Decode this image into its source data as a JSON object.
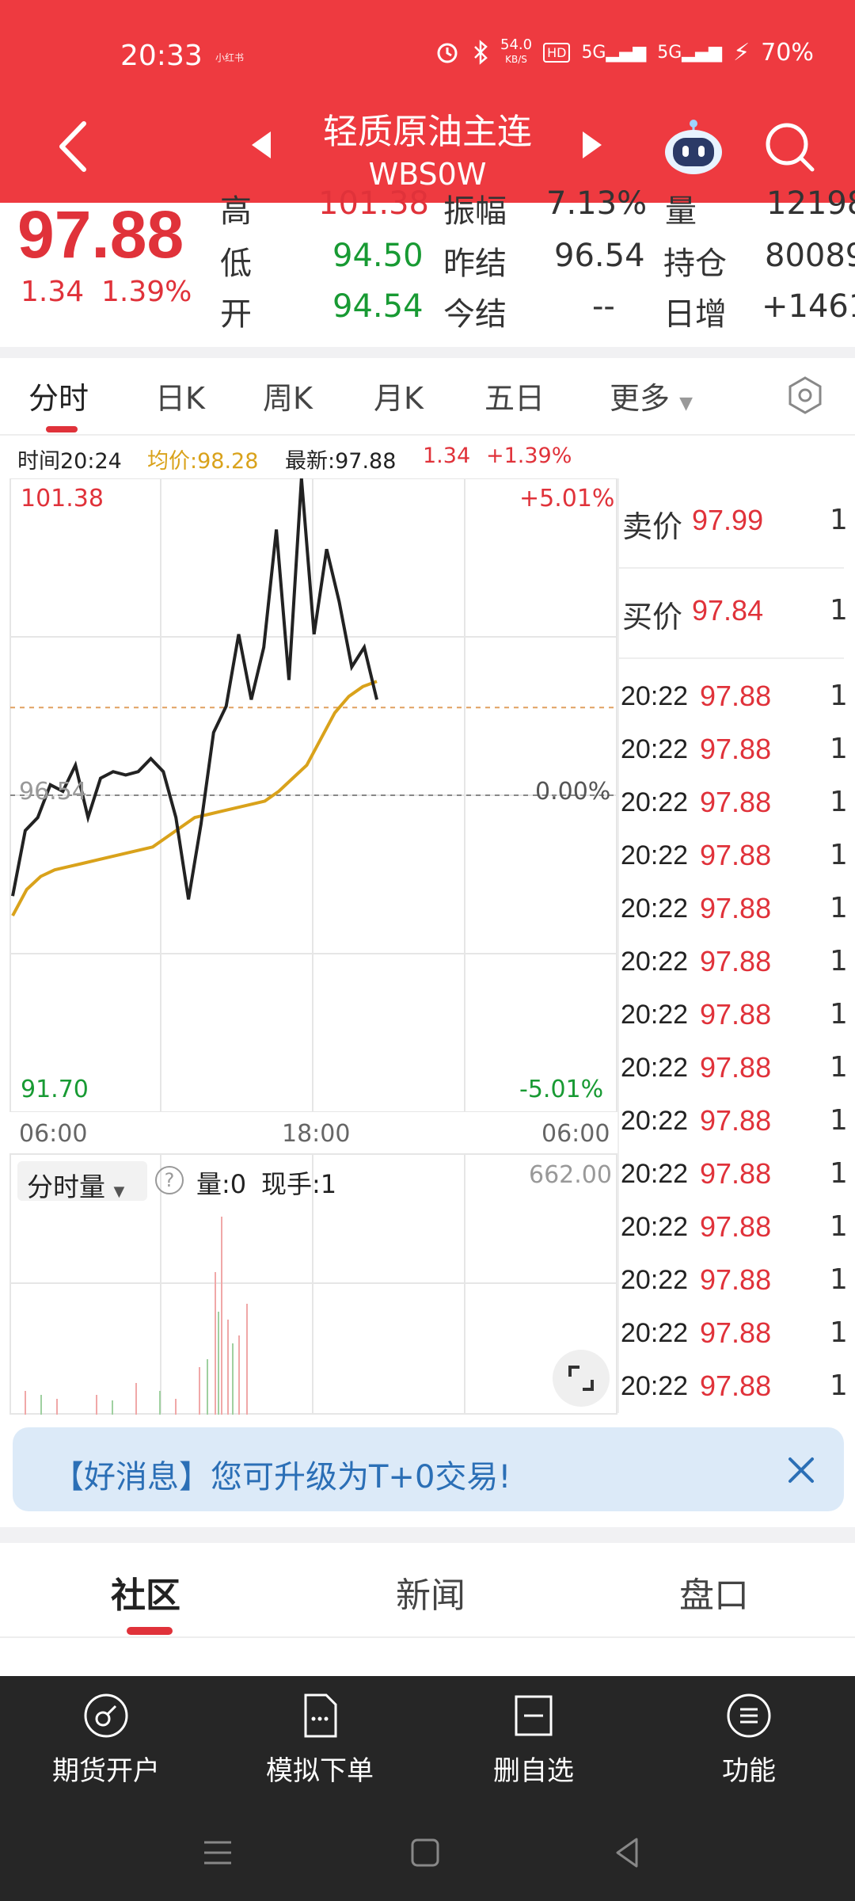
{
  "status_bar": {
    "time": "20:33",
    "tag": "小红书",
    "net_speed": "54.0",
    "net_unit": "KB/S",
    "hd": "HD",
    "signal1": "5G",
    "signal2": "5G",
    "battery": "70%"
  },
  "header": {
    "title": "轻质原油主连",
    "code": "WBS0W"
  },
  "quote": {
    "price": "97.88",
    "change": "1.34",
    "change_pct": "1.39%",
    "high_label": "高",
    "high_value": "101.38",
    "amp_label": "振幅",
    "amp_value": "7.13%",
    "vol_label": "量",
    "vol_value": "12198",
    "low_label": "低",
    "low_value": "94.50",
    "prev_label": "昨结",
    "prev_value": "96.54",
    "oi_label": "持仓",
    "oi_value": "80089",
    "open_label": "开",
    "open_value": "94.54",
    "settle_label": "今结",
    "settle_value": "--",
    "daily_inc_label": "日增",
    "daily_inc_value": "+1461"
  },
  "chart_tabs": [
    "分时",
    "日K",
    "周K",
    "月K",
    "五日",
    "更多"
  ],
  "info_bar": {
    "time": "时间20:24",
    "avg": "均价:98.28",
    "latest": "最新:97.88",
    "change": "1.34",
    "change_pct": "+1.39%"
  },
  "chart_data": {
    "type": "line",
    "y_max_label": "101.38",
    "y_mid_label": "96.54",
    "y_min_label": "91.70",
    "pct_max_label": "+5.01%",
    "pct_mid_label": "0.00%",
    "pct_min_label": "-5.01%",
    "x_labels": [
      "06:00",
      "18:00",
      "06:00"
    ],
    "ylim": [
      91.7,
      101.38
    ],
    "series": [
      {
        "values": [
          95.0,
          96.0,
          96.2,
          96.7,
          96.6,
          97.0,
          96.2,
          96.8,
          96.9,
          96.85,
          96.9,
          97.1,
          96.9,
          96.2,
          94.95,
          96.1,
          97.5,
          97.9,
          99.0,
          98.0,
          98.8,
          100.6,
          98.3,
          101.38,
          99.0,
          100.3,
          99.5,
          98.5,
          98.8,
          98.0
        ]
      },
      {
        "values": [
          94.7,
          95.1,
          95.3,
          95.4,
          95.45,
          95.5,
          95.55,
          95.6,
          95.65,
          95.7,
          95.75,
          95.9,
          96.05,
          96.2,
          96.25,
          96.3,
          96.35,
          96.4,
          96.45,
          96.6,
          96.8,
          97.0,
          97.4,
          97.8,
          98.05,
          98.2,
          98.28
        ]
      }
    ],
    "volume_max_label": "662.00"
  },
  "order_book": {
    "ask_label": "卖价",
    "ask_price": "97.99",
    "ask_vol": "1",
    "bid_label": "买价",
    "bid_price": "97.84",
    "bid_vol": "1",
    "ticks": [
      {
        "time": "20:22",
        "price": "97.88",
        "vol": "1"
      },
      {
        "time": "20:22",
        "price": "97.88",
        "vol": "1"
      },
      {
        "time": "20:22",
        "price": "97.88",
        "vol": "1"
      },
      {
        "time": "20:22",
        "price": "97.88",
        "vol": "1"
      },
      {
        "time": "20:22",
        "price": "97.88",
        "vol": "1"
      },
      {
        "time": "20:22",
        "price": "97.88",
        "vol": "1"
      },
      {
        "time": "20:22",
        "price": "97.88",
        "vol": "1"
      },
      {
        "time": "20:22",
        "price": "97.88",
        "vol": "1"
      },
      {
        "time": "20:22",
        "price": "97.88",
        "vol": "1"
      },
      {
        "time": "20:22",
        "price": "97.88",
        "vol": "1"
      },
      {
        "time": "20:22",
        "price": "97.88",
        "vol": "1"
      },
      {
        "time": "20:22",
        "price": "97.88",
        "vol": "1"
      },
      {
        "time": "20:22",
        "price": "97.88",
        "vol": "1"
      },
      {
        "time": "20:22",
        "price": "97.88",
        "vol": "1"
      }
    ]
  },
  "volume_panel": {
    "selector": "分时量",
    "help": "?",
    "qty": "量:0",
    "now_hand": "现手:1"
  },
  "banner": {
    "text": "【好消息】您可升级为T+0交易!"
  },
  "sub_tabs": [
    "社区",
    "新闻",
    "盘口"
  ],
  "bottom_nav": [
    "期货开户",
    "模拟下单",
    "删自选",
    "功能"
  ],
  "colors": {
    "header_red": "#ee3a40",
    "price_red": "#e0323a",
    "price_green": "#189a33",
    "avg_line": "#d9a21b",
    "price_line": "#222222",
    "banner_bg": "#dceaf8",
    "bottom_bar": "#262626"
  }
}
